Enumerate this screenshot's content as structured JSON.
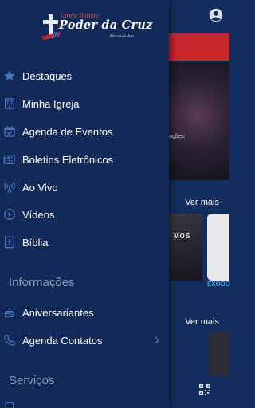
{
  "background": {
    "hero_caption": "ações.",
    "see_more_1": "Ver mais",
    "see_more_2": "Ver mais",
    "card_a_text": "MOS",
    "card_a_under": "S",
    "card_b_label": "ÊXODO"
  },
  "drawer": {
    "logo": {
      "top": "Igreja Batista",
      "main": "Poder da Cruz",
      "sub": "Manaus-Am"
    },
    "items": [
      {
        "label": "Destaques",
        "icon": "star-icon"
      },
      {
        "label": "Minha Igreja",
        "icon": "building-icon"
      },
      {
        "label": "Agenda de Eventos",
        "icon": "calendar-icon"
      },
      {
        "label": "Boletins Eletrônicos",
        "icon": "newspaper-icon"
      },
      {
        "label": "Ao Vivo",
        "icon": "broadcast-icon"
      },
      {
        "label": "Vídeos",
        "icon": "play-circle-icon"
      },
      {
        "label": "Bíblia",
        "icon": "bible-icon"
      }
    ],
    "section_info": "Informações",
    "info_items": [
      {
        "label": "Aniversariantes",
        "icon": "cake-icon"
      },
      {
        "label": "Agenda Contatos",
        "icon": "phone-icon"
      }
    ],
    "section_services": "Serviços",
    "colors": {
      "drawer_bg": "#112a57",
      "accent_red": "#c8252d",
      "icon_blue": "#4b73b8"
    }
  }
}
